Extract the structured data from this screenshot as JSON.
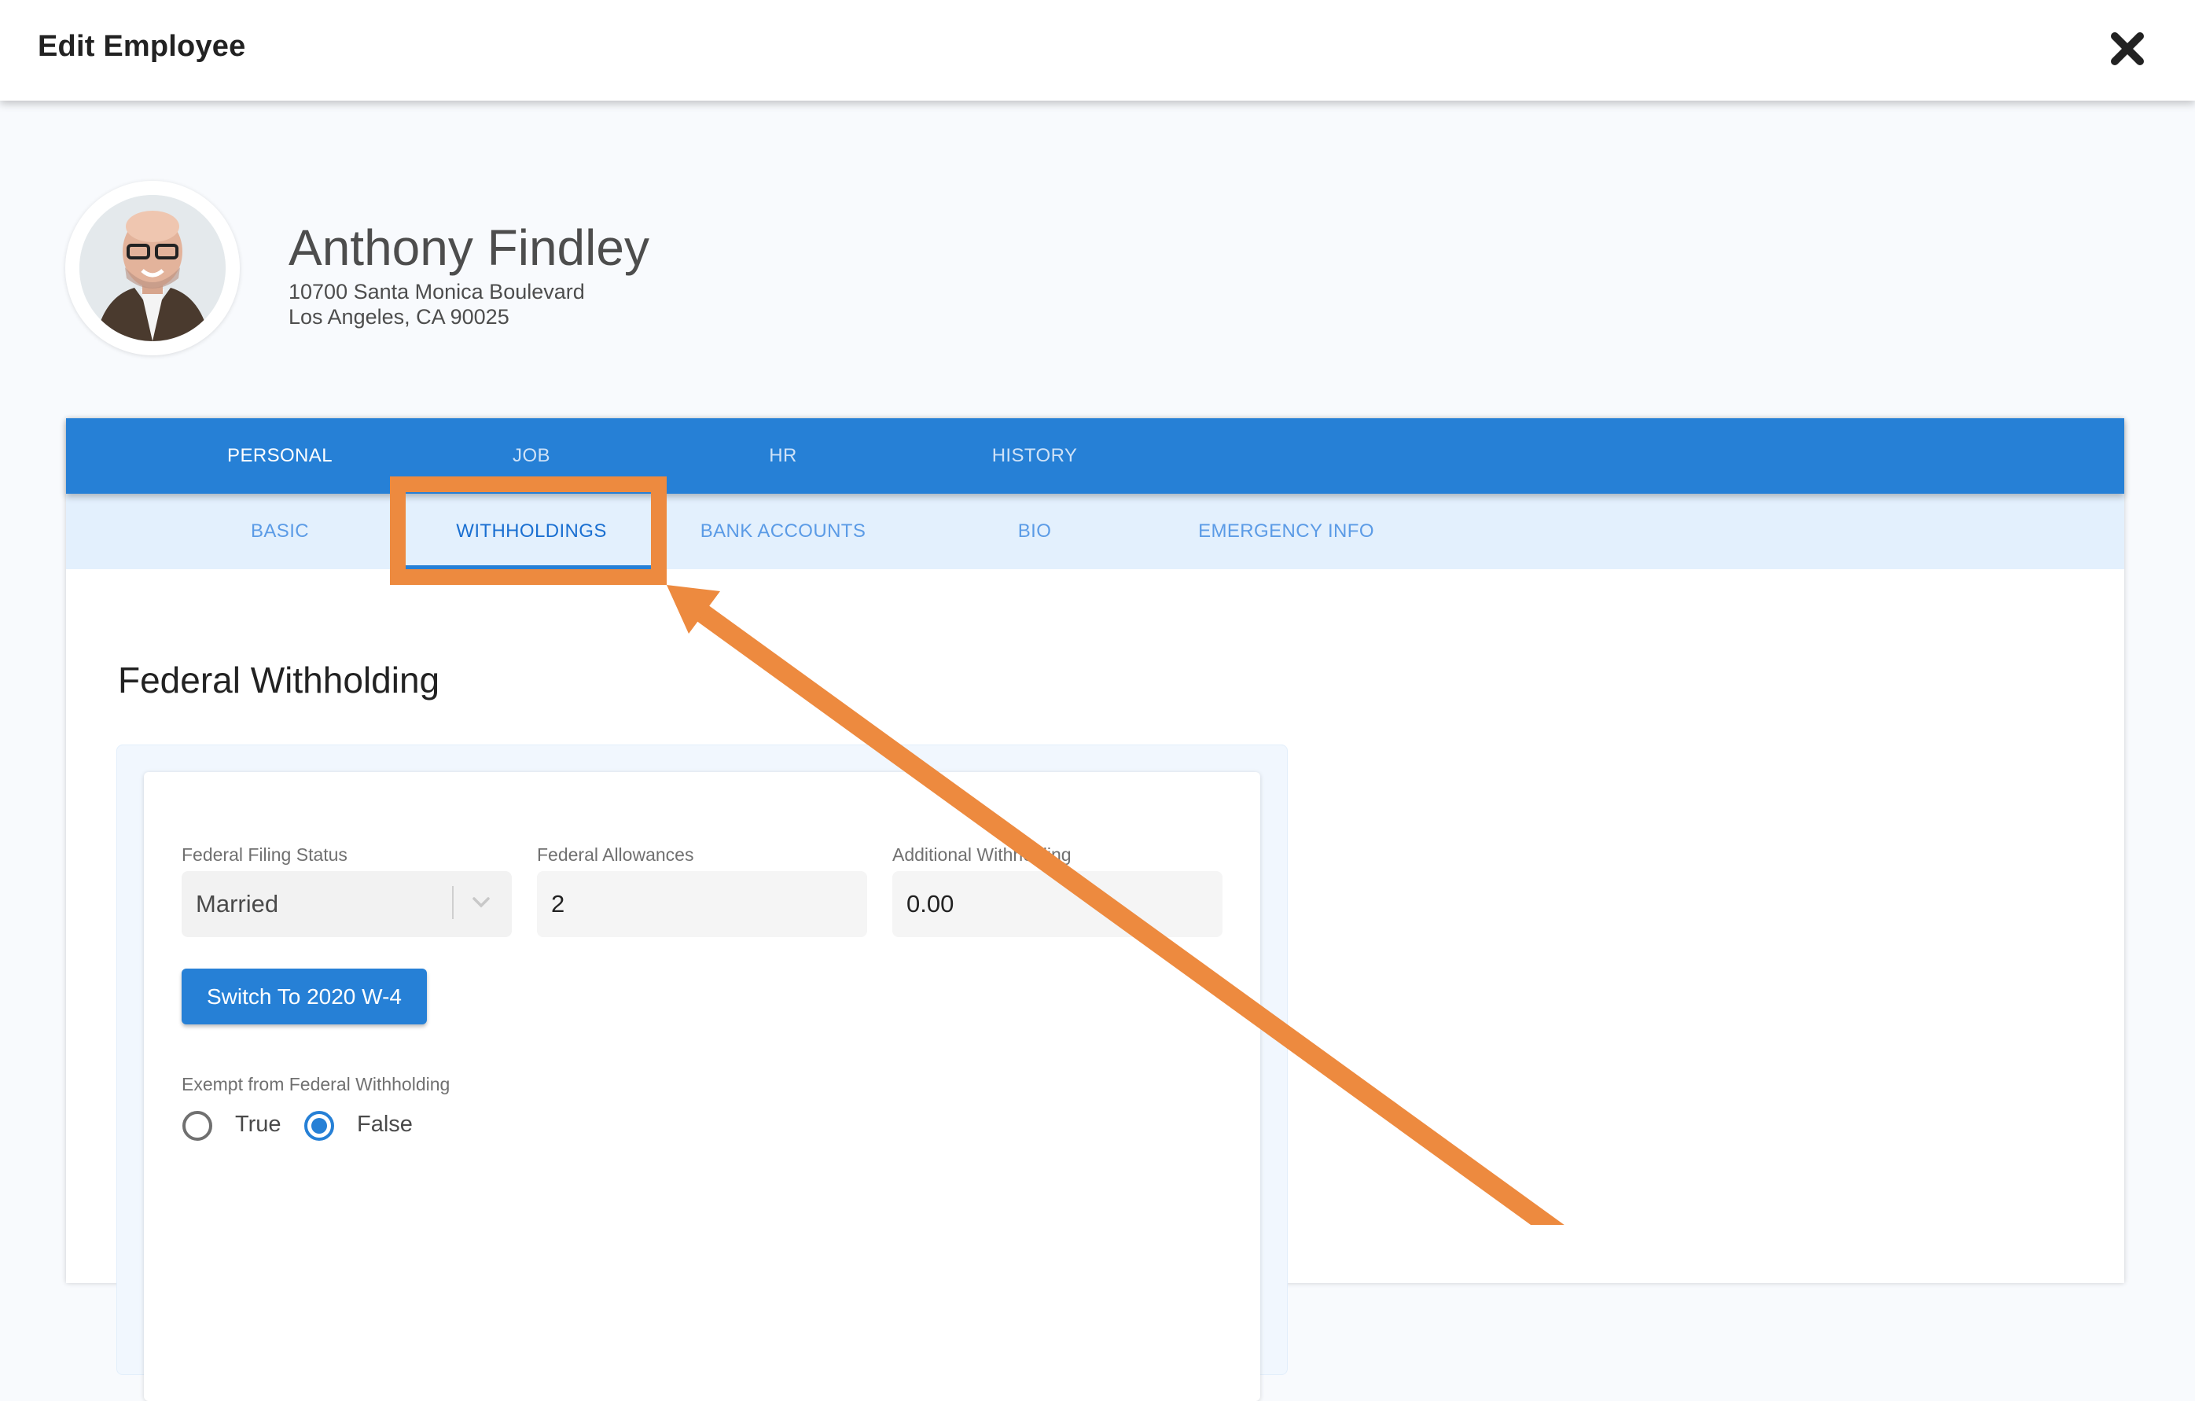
{
  "header": {
    "title": "Edit Employee",
    "close_icon": "close-icon"
  },
  "profile": {
    "name": "Anthony Findley",
    "address_line1": "10700 Santa Monica Boulevard",
    "address_line2": "Los Angeles, CA 90025",
    "avatar_icon": "person-photo"
  },
  "tabs": {
    "primary": [
      {
        "label": "PERSONAL",
        "active": true
      },
      {
        "label": "JOB",
        "active": false
      },
      {
        "label": "HR",
        "active": false
      },
      {
        "label": "HISTORY",
        "active": false
      }
    ],
    "secondary": [
      {
        "label": "BASIC",
        "active": false
      },
      {
        "label": "WITHHOLDINGS",
        "active": true
      },
      {
        "label": "BANK ACCOUNTS",
        "active": false
      },
      {
        "label": "BIO",
        "active": false
      },
      {
        "label": "EMERGENCY INFO",
        "active": false
      }
    ]
  },
  "section": {
    "title": "Federal Withholding",
    "fields": {
      "filing_status": {
        "label": "Federal Filing Status",
        "value": "Married"
      },
      "allowances": {
        "label": "Federal Allowances",
        "value": "2"
      },
      "additional": {
        "label": "Additional Withholding",
        "value": "0.00"
      }
    },
    "switch_button": "Switch To 2020 W-4",
    "exempt": {
      "label": "Exempt from Federal Withholding",
      "options": [
        {
          "label": "True",
          "selected": false
        },
        {
          "label": "False",
          "selected": true
        }
      ]
    }
  },
  "colors": {
    "primary_blue": "#2680d6",
    "subtab_bg": "#e3f0fd",
    "annotation_orange": "#ed8a3f",
    "page_bg": "#f8fafd"
  },
  "annotation": {
    "type": "highlight-box-with-arrow",
    "target": "WITHHOLDINGS"
  }
}
